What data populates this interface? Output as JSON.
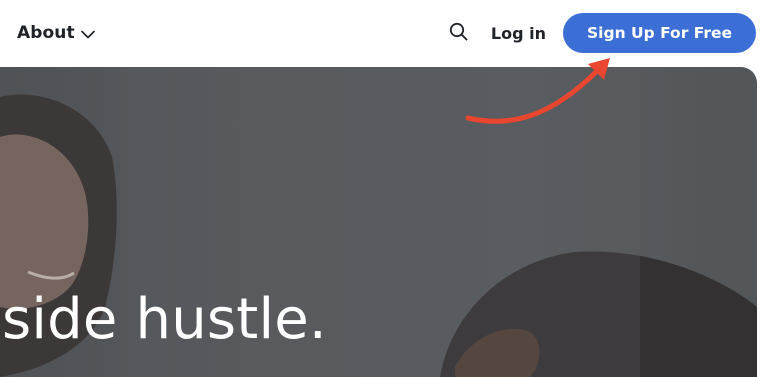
{
  "nav": {
    "about_label": "About",
    "login_label": "Log in",
    "signup_label": "Sign Up For Free",
    "icons": {
      "about_dropdown": "chevron-down-icon",
      "search": "search-icon"
    }
  },
  "hero": {
    "title": "side hustle."
  },
  "annotation": {
    "arrow": "arrow-icon",
    "arrow_color": "#e8462f"
  },
  "colors": {
    "accent": "#3b6fd6",
    "nav_text": "#1f2328",
    "hero_overlay": "#55585c"
  }
}
